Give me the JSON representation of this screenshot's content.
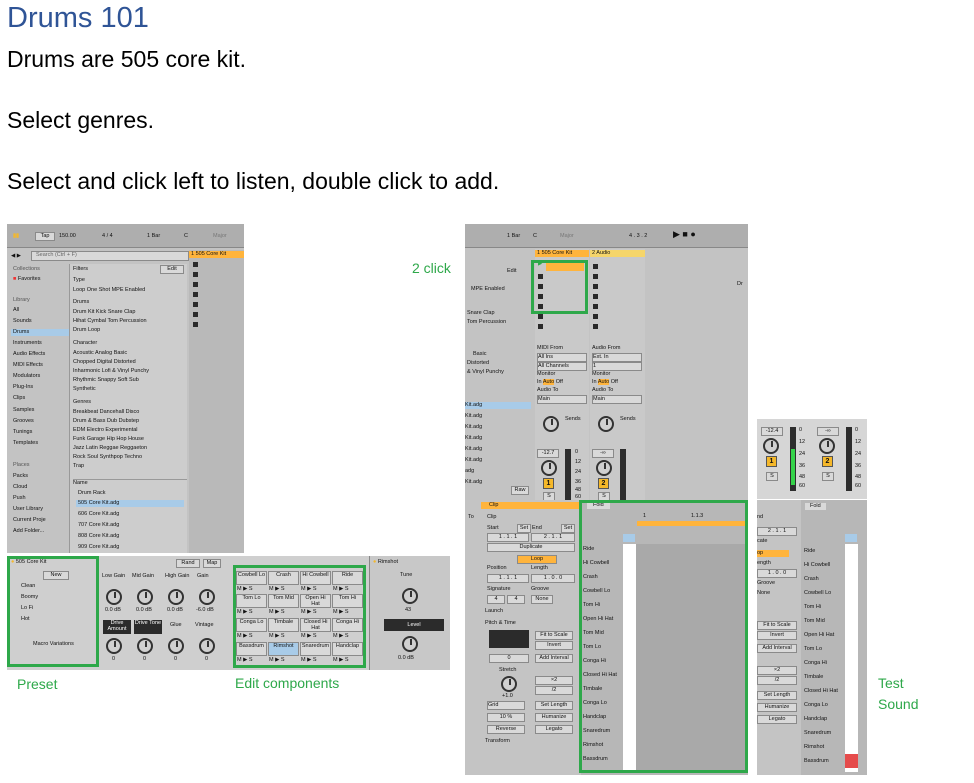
{
  "doc": {
    "title": "Drums 101",
    "line1": "Drums are 505 core kit.",
    "line2": "Select genres.",
    "line3": "Select and click left to listen, double click to add."
  },
  "annotations": {
    "two_click": "2 click",
    "preset": "Preset",
    "edit_components": "Edit components",
    "test": "Test",
    "sound": "Sound"
  },
  "browser": {
    "toolbar": {
      "tap": "Tap",
      "bpm": "150.00",
      "sig": "4 / 4",
      "quant": "1 Bar",
      "key": "C",
      "scale": "Major"
    },
    "search_placeholder": "Search (Ctrl + F)",
    "collections_label": "Collections",
    "favorites": "Favorites",
    "library_label": "Library",
    "library": [
      "All",
      "Sounds",
      "Drums",
      "Instruments",
      "Audio Effects",
      "MIDI Effects",
      "Modulators",
      "Plug-Ins",
      "Clips",
      "Samples",
      "Grooves",
      "Tunings",
      "Templates"
    ],
    "places_label": "Places",
    "places": [
      "Packs",
      "Cloud",
      "Push",
      "User Library",
      "Current Proje",
      "Add Folder..."
    ],
    "filters_label": "Filters",
    "edit": "Edit",
    "type_label": "Type",
    "type_tags": [
      "Loop",
      "One Shot",
      "MPE Enabled"
    ],
    "drums_label": "Drums",
    "drum_tags": [
      "Drum Kit",
      "Kick",
      "Snare",
      "Clap",
      "Hihat",
      "Cymbal",
      "Tom",
      "Percussion",
      "Drum Loop"
    ],
    "character_label": "Character",
    "character_tags": [
      "Acoustic",
      "Analog",
      "Basic",
      "Chopped",
      "Digital",
      "Distorted",
      "Inharmonic",
      "Lofi & Vinyl",
      "Punchy",
      "Rhythmic",
      "Snappy",
      "Soft",
      "Sub",
      "Synthetic"
    ],
    "genres_label": "Genres",
    "genre_tags": [
      "Breakbeat",
      "Dancehall",
      "Disco",
      "Drum & Bass",
      "Dub",
      "Dubstep",
      "EDM",
      "Electro",
      "Experimental",
      "Funk",
      "Garage",
      "Hip Hop",
      "House",
      "Jazz",
      "Latin",
      "Reggae",
      "Reggaeton",
      "Rock",
      "Soul",
      "Synthpop",
      "Techno",
      "Trap"
    ],
    "name_label": "Name",
    "results": [
      "Drum Rack",
      "505 Core Kit.adg",
      "606 Core Kit.adg",
      "707 Core Kit.adg",
      "808 Core Kit.adg",
      "909 Core Kit.adg"
    ],
    "track_title": "1 505 Core Kit"
  },
  "rack": {
    "title": "505 Core Kit",
    "new": "New",
    "presets": [
      "Clean",
      "Boomy",
      "Lo Fi",
      "Hot"
    ],
    "macro_variations": "Macro Variations",
    "rand": "Rand",
    "map": "Map",
    "macro_labels": [
      "Low Gain",
      "Mid Gain",
      "High Gain",
      "Gain"
    ],
    "macro_values": [
      "0.0 dB",
      "0.0 dB",
      "0.0 dB",
      "-6.0 dB"
    ],
    "macro_labels2": [
      "Drive Amount",
      "Drive Tone",
      "Glue",
      "Vintage"
    ],
    "macro_values2": [
      "0",
      "0",
      "0",
      "0"
    ],
    "pads": [
      [
        "Cowbell Lo",
        "Crash",
        "Hi Cowbell",
        "Ride"
      ],
      [
        "Tom Lo",
        "Tom Mid",
        "Open Hi Hat",
        "Tom Hi"
      ],
      [
        "Conga Lo",
        "Timbale",
        "Closed Hi Hat",
        "Conga Hi"
      ],
      [
        "Bassdrum",
        "Rimshot",
        "Snaredrum",
        "Handclap"
      ]
    ],
    "pad_controls": "M ▶ S",
    "chain_title": "Rimshot",
    "tune": "Tune",
    "tune_value": "43",
    "level": "Level",
    "level_value": "0.0 dB"
  },
  "session": {
    "toolbar": {
      "quant": "1 Bar",
      "key": "C",
      "scale": "Major",
      "position": "4 .  3 .  2"
    },
    "track1": "1 505 Core Kit",
    "track2": "2 Audio",
    "edit": "Edit",
    "mpe": "MPE Enabled",
    "browser_frag": [
      "Snare",
      "Clap",
      "Tom",
      "Percussion",
      "Basic",
      "Distorted",
      "& Vinyl",
      "Punchy"
    ],
    "kit_list": [
      "Kit.adg",
      "Kit.adg",
      "Kit.adg",
      "Kit.adg",
      "Kit.adg",
      "Kit.adg",
      "adg",
      "Kit.adg",
      "Kit.adg"
    ],
    "raw": "Raw",
    "midi_from": "MIDI From",
    "all_ins": "All Ins",
    "all_channels": "All Channels",
    "monitor": "Monitor",
    "monitor_opts": [
      "In",
      "Auto",
      "Off"
    ],
    "audio_to": "Audio To",
    "main": "Main",
    "audio_from": "Audio From",
    "ext_in": "Ext. In",
    "one": "1",
    "sends": "Sends",
    "vol1": "-12.7",
    "vol2": "-∞",
    "track_num1": "1",
    "track_num2": "2",
    "s": "S",
    "db_scale": [
      "0",
      "12",
      "24",
      "36",
      "48",
      "60"
    ],
    "dr": "Dr"
  },
  "mixer_small": {
    "vol1": "-12.4",
    "vol2": "-∞",
    "num1": "1",
    "num2": "2",
    "s": "S",
    "db_scale": [
      "0",
      "12",
      "24",
      "36",
      "48",
      "60"
    ]
  },
  "clip": {
    "tabs": [
      "Clip",
      "Fold"
    ],
    "clip_label": "Clip",
    "start": "Start",
    "end": "End",
    "set": "Set",
    "start_val": "1 .  1 .  1",
    "end_val": "2 .  1 .  1",
    "duplicate": "Duplicate",
    "loop": "Loop",
    "position": "Position",
    "length": "Length",
    "position_val": "1 .  1 .  1",
    "length_val": "1 .  0 .  0",
    "signature": "Signature",
    "groove": "Groove",
    "sig_num": "4",
    "sig_den": "4",
    "none": "None",
    "launch": "Launch",
    "pitch_time": "Pitch & Time",
    "fit_to_scale": "Fit to Scale",
    "invert": "Invert",
    "add_interval": "Add Interval",
    "zero": "0",
    "stretch": "Stretch",
    "x2": "×2",
    "half": "/2",
    "stretch_val": "+1.0",
    "grid": "Grid",
    "set_length": "Set Length",
    "pct": "10 %",
    "humanize": "Humanize",
    "reverse": "Reverse",
    "legato": "Legato",
    "transform": "Transform",
    "bar1": "1",
    "bar2": "1.1.3",
    "rows": [
      "Ride",
      "Hi Cowbell",
      "Crash",
      "Cowbell Lo",
      "Tom Hi",
      "Open Hi Hat",
      "Tom Mid",
      "Tom Lo",
      "Conga Hi",
      "Closed Hi Hat",
      "Timbale",
      "Conga Lo",
      "Handclap",
      "Snaredrum",
      "Rimshot",
      "Bassdrum"
    ]
  },
  "clip_small": {
    "fold": "Fold",
    "frag": [
      "nd",
      "2 .  1 .  1",
      "cate",
      "op",
      "ength",
      "1 .  0 .  0",
      "Groove",
      "None",
      "Fit to Scale",
      "Invert",
      "Add Interval",
      "×2",
      "/2",
      "Set Length",
      "Humanize",
      "Legato"
    ],
    "rows": [
      "Ride",
      "Hi Cowbell",
      "Crash",
      "Cowbell Lo",
      "Tom Hi",
      "Tom Mid",
      "Open Hi Hat",
      "Tom Lo",
      "Conga Hi",
      "Timbale",
      "Closed Hi Hat",
      "Conga Lo",
      "Handclap",
      "Snaredrum",
      "Rimshot",
      "Bassdrum"
    ]
  },
  "colors": {
    "highlight": "#2ea84a",
    "orange": "#ffb43c",
    "selection": "#a8cbe8",
    "title_blue": "#2f5496"
  }
}
